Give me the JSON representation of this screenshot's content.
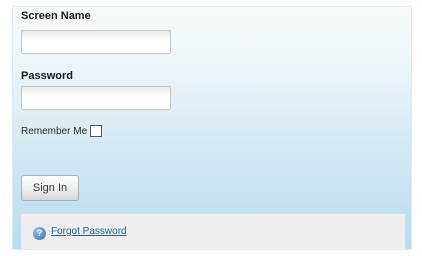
{
  "login": {
    "screen_name_label": "Screen Name",
    "screen_name_value": "",
    "password_label": "Password",
    "password_value": "",
    "remember_label": "Remember Me",
    "remember_checked": false,
    "sign_in_label": "Sign In",
    "forgot_password_label": "Forgot Password",
    "help_icon": "help-circle-icon"
  },
  "colors": {
    "panel_top": "#f7fafb",
    "panel_bottom": "#b7dcec",
    "link": "#2c5d8f",
    "footer": "#eeeeee"
  }
}
